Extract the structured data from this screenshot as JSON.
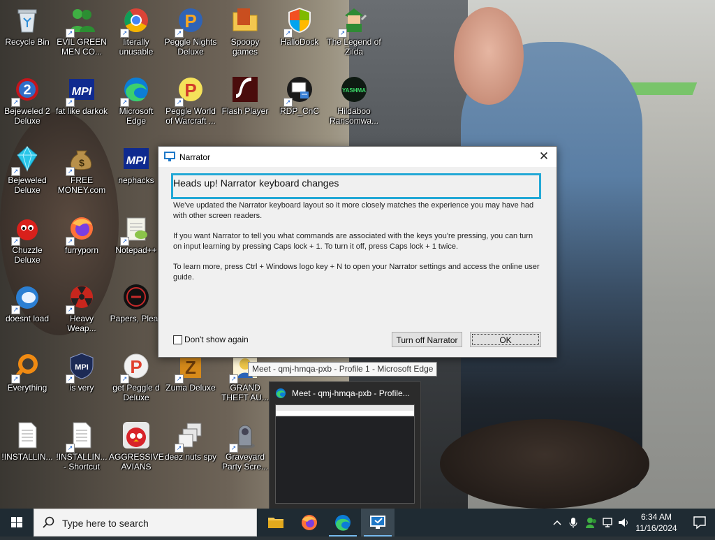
{
  "desktop": {
    "icons": [
      {
        "label": "Recycle Bin",
        "icon": "recycle-bin-icon",
        "shortcut": false
      },
      {
        "label": "EVIL GREEN MEN CO...",
        "icon": "people-icon",
        "shortcut": true
      },
      {
        "label": "literally unusable",
        "icon": "chrome-icon",
        "shortcut": true
      },
      {
        "label": "Peggle Nights Deluxe",
        "icon": "peggle-icon",
        "shortcut": true
      },
      {
        "label": "Spoopy games",
        "icon": "folder-icon",
        "shortcut": false
      },
      {
        "label": "HalloDock",
        "icon": "windows-shield-icon",
        "shortcut": true
      },
      {
        "label": "The Legend of Zilda",
        "icon": "link-icon",
        "shortcut": true
      },
      {
        "label": "Bejeweled 2 Deluxe",
        "icon": "bejeweled2-icon",
        "shortcut": true
      },
      {
        "label": "fat like darkok",
        "icon": "mpi-icon",
        "shortcut": true
      },
      {
        "label": "Microsoft Edge",
        "icon": "edge-icon",
        "shortcut": true
      },
      {
        "label": "Peggle World of Warcraft ...",
        "icon": "peggle-icon",
        "shortcut": true
      },
      {
        "label": "Flash Player",
        "icon": "flash-icon",
        "shortcut": false
      },
      {
        "label": "RDP_CnC",
        "icon": "rdp-icon",
        "shortcut": true
      },
      {
        "label": "Hildaboo Ransomwa...",
        "icon": "yashma-icon",
        "shortcut": false
      },
      {
        "label": "Bejeweled Deluxe",
        "icon": "diamond-icon",
        "shortcut": true
      },
      {
        "label": "FREE MONEY.com",
        "icon": "money-bag-icon",
        "shortcut": true
      },
      {
        "label": "nephacks",
        "icon": "mpi-icon",
        "shortcut": false
      },
      {
        "label": "Chuzzle Deluxe",
        "icon": "chuzzle-icon",
        "shortcut": true
      },
      {
        "label": "furryporn",
        "icon": "firefox-icon",
        "shortcut": true
      },
      {
        "label": "Notepad++",
        "icon": "notepadpp-icon",
        "shortcut": true
      },
      {
        "label": "doesnt load",
        "icon": "blue-bird-icon",
        "shortcut": true
      },
      {
        "label": "Heavy Weap...",
        "icon": "radiation-icon",
        "shortcut": true
      },
      {
        "label": "Papers, Pleas",
        "icon": "papers-please-icon",
        "shortcut": false
      },
      {
        "label": "Everything",
        "icon": "search-ring-icon",
        "shortcut": true
      },
      {
        "label": "is very",
        "icon": "mpi-shield-icon",
        "shortcut": true
      },
      {
        "label": "get Peggle d Deluxe",
        "icon": "peggle-icon",
        "shortcut": true
      },
      {
        "label": "Zuma Deluxe",
        "icon": "zuma-icon",
        "shortcut": true
      },
      {
        "label": "GRAND THEFT AU...",
        "icon": "gta-icon",
        "shortcut": true
      },
      {
        "label": "!INSTALLIN...",
        "icon": "text-file-icon",
        "shortcut": false
      },
      {
        "label": "!INSTALLIN... - Shortcut",
        "icon": "text-file-icon",
        "shortcut": true
      },
      {
        "label": "AGGRESSIVE AVIANS",
        "icon": "angry-bird-icon",
        "shortcut": false
      },
      {
        "label": "deez nuts spy",
        "icon": "stacked-windows-icon",
        "shortcut": true
      },
      {
        "label": "Graveyard Party Scre...",
        "icon": "graveyard-icon",
        "shortcut": true
      }
    ]
  },
  "narrator_dialog": {
    "title": "Narrator",
    "close_glyph": "✕",
    "heading": "Heads up! Narrator keyboard changes",
    "paragraph1": "We've updated the Narrator keyboard layout so it more closely matches the experience you may have had with other screen readers.",
    "paragraph2": "If you want Narrator to tell you what commands are associated with the keys you're pressing, you can turn on input learning by pressing Caps lock + 1. To turn it off, press Caps lock + 1 twice.",
    "paragraph3": "To learn more, press Ctrl + Windows logo key + N to open your Narrator settings and access the online user guide.",
    "checkbox_label": "Don't show again",
    "checkbox_checked": false,
    "turn_off_button": "Turn off Narrator",
    "ok_button": "OK"
  },
  "taskbar_tooltip": "Meet - qmj-hmqa-pxb - Profile 1 - Microsoft Edge",
  "thumbnail": {
    "title": "Meet - qmj-hmqa-pxb - Profile..."
  },
  "taskbar": {
    "search_placeholder": "Type here to search",
    "apps": [
      {
        "name": "File Explorer",
        "icon": "file-explorer-icon",
        "active": false
      },
      {
        "name": "Firefox",
        "icon": "firefox-icon",
        "active": false
      },
      {
        "name": "Microsoft Edge",
        "icon": "edge-icon",
        "active": false
      },
      {
        "name": "Narrator",
        "icon": "narrator-icon",
        "active": true
      }
    ],
    "tray_icons": [
      "chevron-up-icon",
      "microphone-icon",
      "people-icon",
      "network-icon",
      "volume-icon"
    ],
    "time": "6:34 AM",
    "date": "11/16/2024"
  },
  "colors": {
    "taskbar_bg": "#1f2b33",
    "focus_box": "#22a8d6",
    "ok_border": "#0078d7",
    "dialog_bg": "#f0f0f0"
  }
}
